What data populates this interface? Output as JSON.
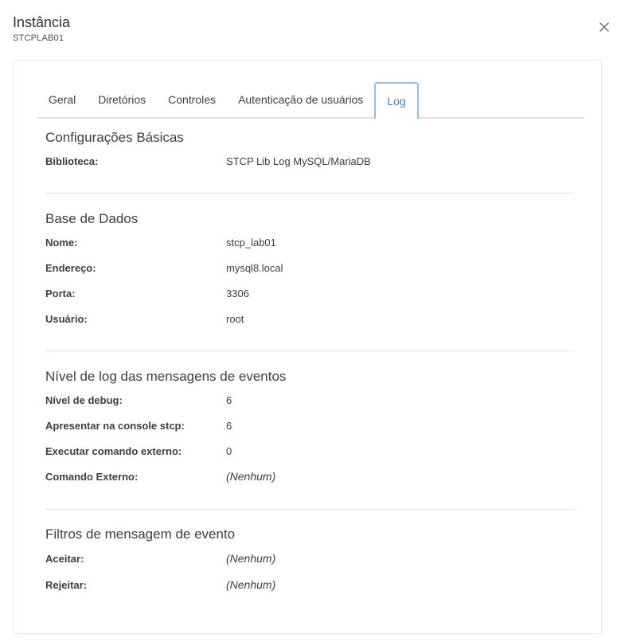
{
  "header": {
    "title": "Instância",
    "subtitle": "STCPLAB01"
  },
  "icons": {
    "close": "close-icon"
  },
  "tabs": [
    {
      "label": "Geral"
    },
    {
      "label": "Diretórios"
    },
    {
      "label": "Controles"
    },
    {
      "label": "Autenticação de usuários"
    },
    {
      "label": "Log",
      "active": true
    }
  ],
  "sections": {
    "basic": {
      "title": "Configurações Básicas",
      "rows": [
        {
          "label": "Biblioteca:",
          "value": "STCP Lib Log MySQL/MariaDB"
        }
      ]
    },
    "database": {
      "title": "Base de Dados",
      "rows": [
        {
          "label": "Nome:",
          "value": "stcp_lab01"
        },
        {
          "label": "Endereço:",
          "value": "mysql8.local"
        },
        {
          "label": "Porta:",
          "value": "3306"
        },
        {
          "label": "Usuário:",
          "value": "root"
        }
      ]
    },
    "loglevel": {
      "title": "Nível de log das mensagens de eventos",
      "rows": [
        {
          "label": "Nível de debug:",
          "value": "6"
        },
        {
          "label": "Apresentar na console stcp:",
          "value": "6"
        },
        {
          "label": "Executar comando externo:",
          "value": "0"
        },
        {
          "label": "Comando Externo:",
          "value": "(Nenhum)"
        }
      ]
    },
    "filters": {
      "title": "Filtros de mensagem de evento",
      "rows": [
        {
          "label": "Aceitar:",
          "value": "(Nenhum)"
        },
        {
          "label": "Rejeitar:",
          "value": "(Nenhum)"
        }
      ]
    }
  },
  "colors": {
    "accent": "#3a86d4",
    "tab_border": "#8ec1ee",
    "divider": "#e2e4e7"
  }
}
